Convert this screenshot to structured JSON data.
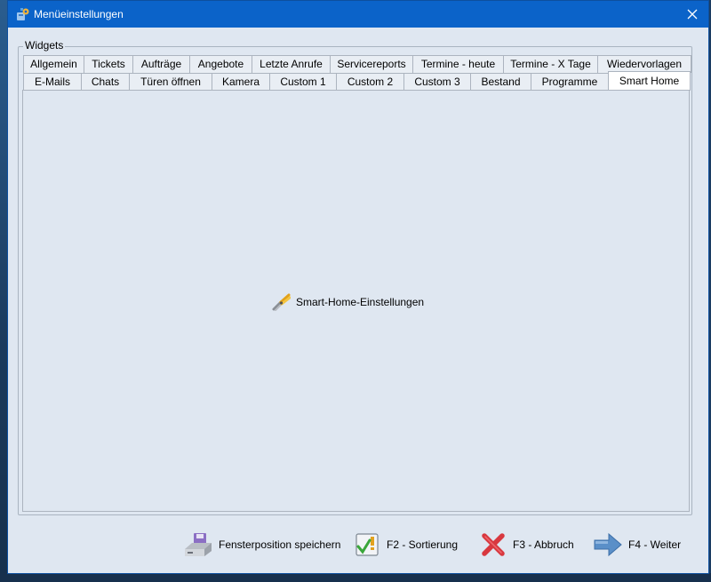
{
  "window": {
    "title": "Menüeinstellungen"
  },
  "group": {
    "legend": "Widgets"
  },
  "tabs_row1": [
    {
      "label": "Allgemein"
    },
    {
      "label": "Tickets"
    },
    {
      "label": "Aufträge"
    },
    {
      "label": "Angebote"
    },
    {
      "label": "Letzte Anrufe"
    },
    {
      "label": "Servicereports"
    },
    {
      "label": "Termine - heute"
    },
    {
      "label": "Termine - X Tage"
    },
    {
      "label": "Wiedervorlagen"
    }
  ],
  "tabs_row2": [
    {
      "label": "E-Mails"
    },
    {
      "label": "Chats"
    },
    {
      "label": "Türen öffnen"
    },
    {
      "label": "Kamera"
    },
    {
      "label": "Custom 1"
    },
    {
      "label": "Custom 2"
    },
    {
      "label": "Custom 3"
    },
    {
      "label": "Bestand"
    },
    {
      "label": "Programme"
    },
    {
      "label": "Smart Home"
    }
  ],
  "active_tab": "Smart Home",
  "panel": {
    "link_label": "Smart-Home-Einstellungen"
  },
  "buttons": {
    "save_position": "Fensterposition speichern",
    "sorting": "F2 - Sortierung",
    "cancel": "F3 - Abbruch",
    "next": "F4 - Weiter"
  },
  "colors": {
    "titlebar": "#0b63c9",
    "window_bg": "#dfe7f1",
    "tab_border": "#acb4bf"
  }
}
